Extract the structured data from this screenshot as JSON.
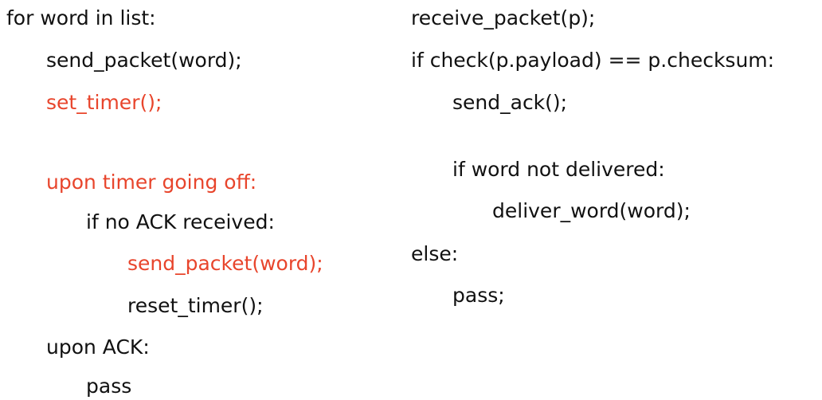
{
  "colors": {
    "text": "#111111",
    "highlight": "#e8452c"
  },
  "sender": {
    "lines": [
      {
        "text": "for word in list:",
        "highlight": false
      },
      {
        "text": "send_packet(word);",
        "highlight": false
      },
      {
        "text": "set_timer();",
        "highlight": true
      },
      {
        "text": "upon timer going off:",
        "highlight": true
      },
      {
        "text": "if no ACK received:",
        "highlight": false
      },
      {
        "text": "send_packet(word);",
        "highlight": true
      },
      {
        "text": "reset_timer();",
        "highlight": false
      },
      {
        "text": "upon ACK:",
        "highlight": false
      },
      {
        "text": "pass",
        "highlight": false
      }
    ]
  },
  "receiver": {
    "lines": [
      {
        "text": "receive_packet(p);",
        "highlight": false
      },
      {
        "text": "if check(p.payload) == p.checksum:",
        "highlight": false
      },
      {
        "text": "send_ack();",
        "highlight": false
      },
      {
        "text": "if word not delivered:",
        "highlight": false
      },
      {
        "text": "deliver_word(word);",
        "highlight": false
      },
      {
        "text": "else:",
        "highlight": false
      },
      {
        "text": "pass;",
        "highlight": false
      }
    ]
  }
}
